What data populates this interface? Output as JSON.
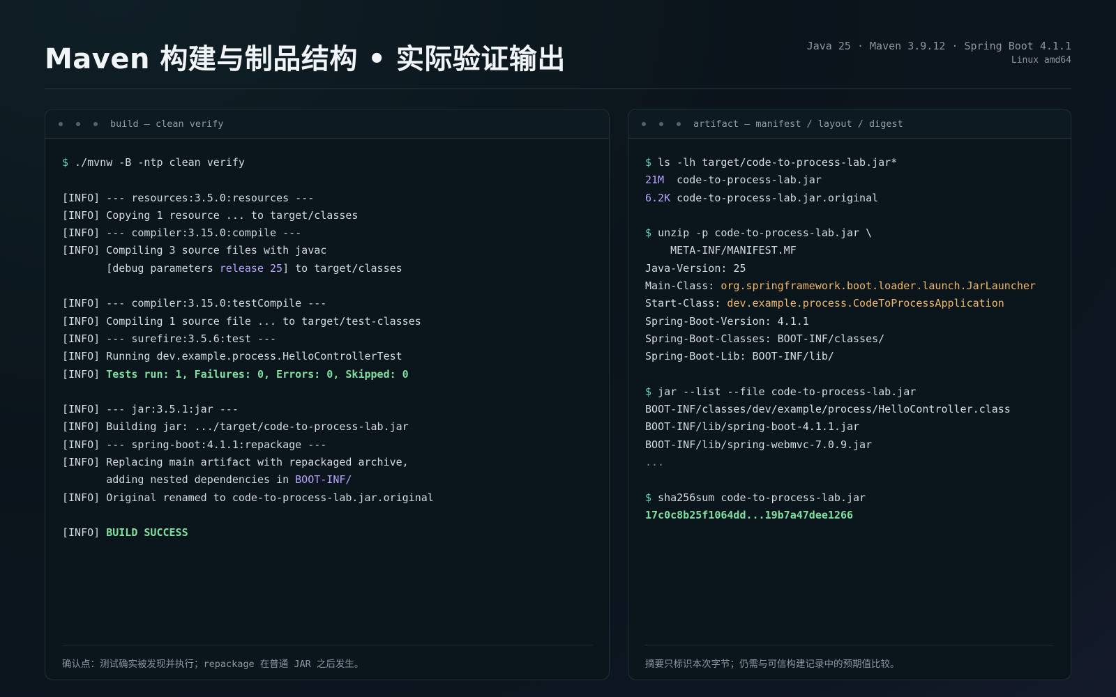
{
  "header": {
    "title": "Maven 构建与制品结构 • 实际验证输出",
    "meta_line1": "Java 25 · Maven 3.9.12 · Spring Boot 4.1.1",
    "meta_line2": "Linux amd64"
  },
  "left_panel": {
    "title": "build — clean verify",
    "lines": [
      {
        "p": "$",
        "t": " ./mvnw -B -ntp clean verify"
      },
      {
        "t": ""
      },
      {
        "t": "[INFO] --- resources:3.5.0:resources ---"
      },
      {
        "t": "[INFO] Copying 1 resource ... to target/classes"
      },
      {
        "t": "[INFO] --- compiler:3.15.0:compile ---"
      },
      {
        "t": "[INFO] Compiling 3 source files with javac"
      },
      {
        "t": "       [debug parameters ",
        "h": "release 25",
        "a": "] to target/classes"
      },
      {
        "t": ""
      },
      {
        "t": "[INFO] --- compiler:3.15.0:testCompile ---"
      },
      {
        "t": "[INFO] Compiling 1 source file ... to target/test-classes"
      },
      {
        "t": "[INFO] --- surefire:3.5.6:test ---"
      },
      {
        "t": "[INFO] Running dev.example.process.HelloControllerTest"
      },
      {
        "t": "[INFO] ",
        "ok": "Tests run: 1, Failures: 0, Errors: 0, Skipped: 0"
      },
      {
        "t": ""
      },
      {
        "t": "[INFO] --- jar:3.5.1:jar ---"
      },
      {
        "t": "[INFO] Building jar: .../target/code-to-process-lab.jar"
      },
      {
        "t": "[INFO] --- spring-boot:4.1.1:repackage ---"
      },
      {
        "t": "[INFO] Replacing main artifact with repackaged archive,"
      },
      {
        "t": "       adding nested dependencies in ",
        "h": "BOOT-INF/"
      },
      {
        "t": "[INFO] Original renamed to code-to-process-lab.jar.original"
      },
      {
        "t": ""
      },
      {
        "t": "[INFO] ",
        "ok": "BUILD SUCCESS"
      }
    ],
    "footer": "确认点：测试确实被发现并执行；repackage 在普通 JAR 之后发生。"
  },
  "right_panel": {
    "title": "artifact — manifest / layout / digest",
    "lines": [
      {
        "p": "$",
        "t": " ls -lh target/code-to-process-lab.jar*"
      },
      {
        "s": "21M ",
        "t": " code-to-process-lab.jar"
      },
      {
        "s": "6.2K",
        "t": " code-to-process-lab.jar.original"
      },
      {
        "t": ""
      },
      {
        "p": "$",
        "t": " unzip -p code-to-process-lab.jar \\"
      },
      {
        "t": "    META-INF/MANIFEST.MF"
      },
      {
        "t": "Java-Version: 25"
      },
      {
        "t": "Main-Class: ",
        "c": "org.springframework.boot.loader.launch.JarLauncher"
      },
      {
        "t": "Start-Class: ",
        "c": "dev.example.process.CodeToProcessApplication"
      },
      {
        "t": "Spring-Boot-Version: 4.1.1"
      },
      {
        "t": "Spring-Boot-Classes: BOOT-INF/classes/"
      },
      {
        "t": "Spring-Boot-Lib: BOOT-INF/lib/"
      },
      {
        "t": ""
      },
      {
        "p": "$",
        "t": " jar --list --file code-to-process-lab.jar"
      },
      {
        "t": "BOOT-INF/classes/dev/example/process/HelloController.class"
      },
      {
        "t": "BOOT-INF/lib/spring-boot-4.1.1.jar"
      },
      {
        "t": "BOOT-INF/lib/spring-webmvc-7.0.9.jar"
      },
      {
        "m": "..."
      },
      {
        "t": ""
      },
      {
        "p": "$",
        "t": " sha256sum code-to-process-lab.jar"
      },
      {
        "ok": "17c0c8b25f1064dd...19b7a47dee1266"
      }
    ],
    "footer": "摘要只标识本次字节；仍需与可信构建记录中的预期值比较。"
  }
}
